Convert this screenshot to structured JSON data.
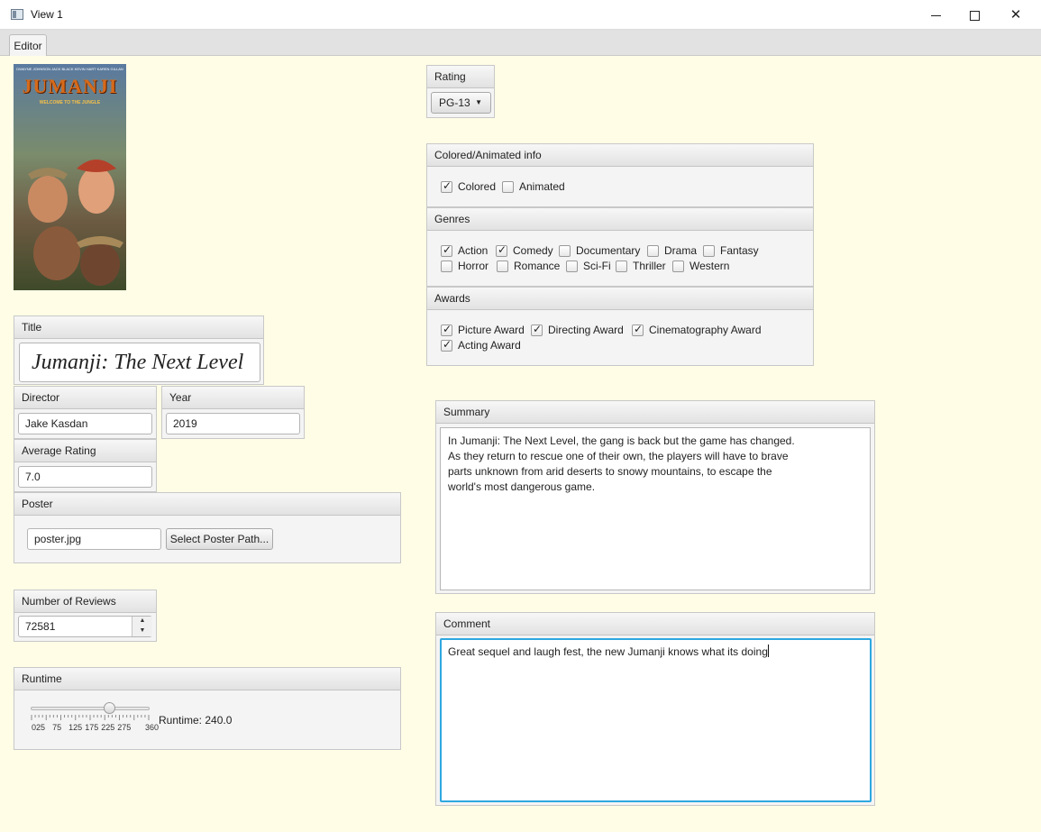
{
  "window": {
    "title": "View 1"
  },
  "tabs": [
    {
      "label": "Editor"
    }
  ],
  "poster": {
    "cast_names": "DWAYNE JOHNSON  JACK BLACK  KEVIN HART  KAREN GILLAN",
    "logo_text": "JUMANJI",
    "logo_subtitle": "WELCOME TO THE JUNGLE"
  },
  "title_pane": {
    "label": "Title",
    "value": "Jumanji: The Next Level"
  },
  "director_pane": {
    "label": "Director",
    "value": "Jake Kasdan"
  },
  "year_pane": {
    "label": "Year",
    "value": "2019"
  },
  "avg_rating_pane": {
    "label": "Average Rating",
    "value": "7.0"
  },
  "poster_pane": {
    "label": "Poster",
    "path": "poster.jpg",
    "button": "Select Poster Path..."
  },
  "reviews_pane": {
    "label": "Number of Reviews",
    "value": "72581"
  },
  "runtime_pane": {
    "label": "Runtime",
    "slider_value": 240,
    "slider_min": 0,
    "slider_max": 360,
    "tick_labels": [
      "0",
      "25",
      "75",
      "125",
      "175",
      "225",
      "275",
      "360"
    ],
    "readout": "Runtime: 240.0"
  },
  "rating_pane": {
    "label": "Rating",
    "selected": "PG-13"
  },
  "color_pane": {
    "label": "Colored/Animated info",
    "items": [
      {
        "label": "Colored",
        "checked": true
      },
      {
        "label": "Animated",
        "checked": false
      }
    ]
  },
  "genres_pane": {
    "label": "Genres",
    "items": [
      {
        "label": "Action",
        "checked": true
      },
      {
        "label": "Comedy",
        "checked": true
      },
      {
        "label": "Documentary",
        "checked": false
      },
      {
        "label": "Drama",
        "checked": false
      },
      {
        "label": "Fantasy",
        "checked": false
      },
      {
        "label": "Horror",
        "checked": false
      },
      {
        "label": "Romance",
        "checked": false
      },
      {
        "label": "Sci-Fi",
        "checked": false
      },
      {
        "label": "Thriller",
        "checked": false
      },
      {
        "label": "Western",
        "checked": false
      }
    ]
  },
  "awards_pane": {
    "label": "Awards",
    "items": [
      {
        "label": "Picture Award",
        "checked": true
      },
      {
        "label": "Directing Award",
        "checked": true
      },
      {
        "label": "Cinematography Award",
        "checked": true
      },
      {
        "label": "Acting Award",
        "checked": true
      }
    ]
  },
  "summary_pane": {
    "label": "Summary",
    "text": "In Jumanji: The Next Level, the gang is back but the game has changed.\nAs they return to rescue one of their own, the players will have to brave\nparts unknown from arid deserts to snowy mountains, to escape the\nworld's most dangerous game."
  },
  "comment_pane": {
    "label": "Comment",
    "text": "Great sequel and laugh fest, the new Jumanji knows what its doing"
  },
  "colors": {
    "background": "#fffde6",
    "focus": "#2ea7e0",
    "pane": "#f4f4f4"
  }
}
